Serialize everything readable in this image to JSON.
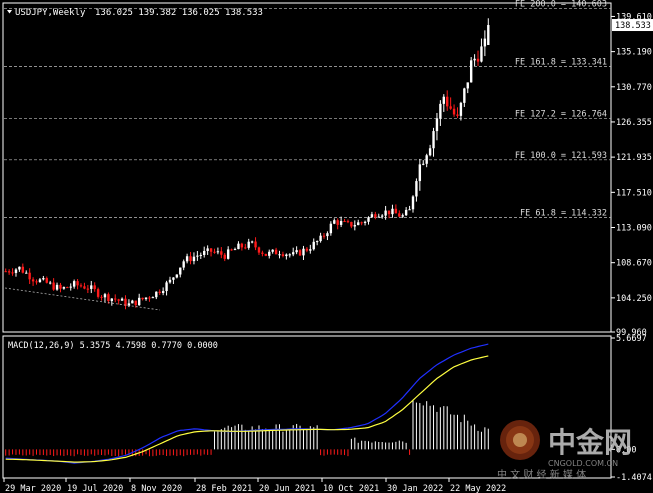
{
  "header": {
    "symbol_timeframe": "USDJPY,Weekly",
    "ohlc": "136.025 139.382 136.025 138.533"
  },
  "price_axis": {
    "labels": [
      "139.610",
      "135.190",
      "130.770",
      "126.355",
      "121.935",
      "117.510",
      "113.090",
      "108.670",
      "104.250",
      "99.960"
    ],
    "current_price": "138.533"
  },
  "fib_levels": [
    {
      "label": "FE 200.0 = 140.603",
      "price": 140.603
    },
    {
      "label": "FE 161.8 = 133.341",
      "price": 133.341
    },
    {
      "label": "FE 127.2 = 126.764",
      "price": 126.764
    },
    {
      "label": "FE 100.0 = 121.593",
      "price": 121.593
    },
    {
      "label": "FE 61.8 = 114.332",
      "price": 114.332
    }
  ],
  "macd": {
    "label": "MACD(12,26,9) 5.3575 4.7598 0.7770 0.0000",
    "axis_labels": [
      "5.6697",
      "0.00",
      "-1.4074"
    ]
  },
  "time_axis": {
    "labels": [
      "29 Mar 2020",
      "19 Jul 2020",
      "8 Nov 2020",
      "28 Feb 2021",
      "20 Jun 2021",
      "10 Oct 2021",
      "30 Jan 2022",
      "22 May 2022"
    ]
  },
  "watermark": {
    "brand": "中金网",
    "domain": "CNGOLD.COM.CN",
    "tagline": "中 文 财 经 新 媒 体"
  },
  "chart_data": {
    "type": "candlestick",
    "title": "USDJPY,Weekly",
    "ylim": [
      99.96,
      141.3
    ],
    "anchors": [
      [
        0,
        107.6
      ],
      [
        4,
        108.0
      ],
      [
        8,
        106.7
      ],
      [
        12,
        106.1
      ],
      [
        16,
        105.3
      ],
      [
        20,
        105.9
      ],
      [
        24,
        105.6
      ],
      [
        28,
        104.6
      ],
      [
        32,
        104.1
      ],
      [
        36,
        103.4
      ],
      [
        40,
        104.1
      ],
      [
        44,
        104.9
      ],
      [
        48,
        106.3
      ],
      [
        52,
        108.9
      ],
      [
        56,
        109.6
      ],
      [
        60,
        110.1
      ],
      [
        64,
        109.6
      ],
      [
        68,
        110.6
      ],
      [
        72,
        111.0
      ],
      [
        76,
        109.7
      ],
      [
        80,
        110.1
      ],
      [
        84,
        109.6
      ],
      [
        88,
        110.4
      ],
      [
        92,
        111.6
      ],
      [
        96,
        113.9
      ],
      [
        100,
        113.4
      ],
      [
        104,
        113.7
      ],
      [
        108,
        114.9
      ],
      [
        112,
        115.1
      ],
      [
        116,
        114.5
      ],
      [
        118,
        115.2
      ],
      [
        120,
        119.9
      ],
      [
        122,
        122.0
      ],
      [
        124,
        123.9
      ],
      [
        126,
        126.9
      ],
      [
        128,
        129.6
      ],
      [
        130,
        128.1
      ],
      [
        132,
        126.5
      ],
      [
        134,
        130.0
      ],
      [
        136,
        133.6
      ],
      [
        138,
        135.0
      ],
      [
        140,
        135.8
      ],
      [
        141,
        138.5
      ]
    ],
    "macd_series": [
      {
        "name": "macd",
        "values": [
          -0.45,
          -0.5,
          -0.55,
          -0.6,
          -0.7,
          -0.62,
          -0.5,
          -0.3,
          0.1,
          0.6,
          0.95,
          1.05,
          0.95,
          0.9,
          0.95,
          1.0,
          1.02,
          1.05,
          1.02,
          1.0,
          1.1,
          1.3,
          1.8,
          2.6,
          3.6,
          4.3,
          4.8,
          5.15,
          5.36
        ]
      },
      {
        "name": "signal",
        "values": [
          -0.5,
          -0.52,
          -0.56,
          -0.6,
          -0.65,
          -0.63,
          -0.55,
          -0.4,
          -0.1,
          0.3,
          0.7,
          0.9,
          0.95,
          0.92,
          0.92,
          0.95,
          0.98,
          1.0,
          1.02,
          1.0,
          1.02,
          1.1,
          1.4,
          2.0,
          2.8,
          3.6,
          4.2,
          4.55,
          4.76
        ]
      }
    ]
  },
  "colors": {
    "background": "#000000",
    "axis": "#ffffff",
    "bull": "#ffffff",
    "bear": "#ff1a1a",
    "fib_line": "#c0c0c0",
    "macd_main": "#2030ff",
    "macd_signal": "#ffff40",
    "histogram_pos": "#ffffff",
    "histogram_neg": "#ff1a1a"
  }
}
